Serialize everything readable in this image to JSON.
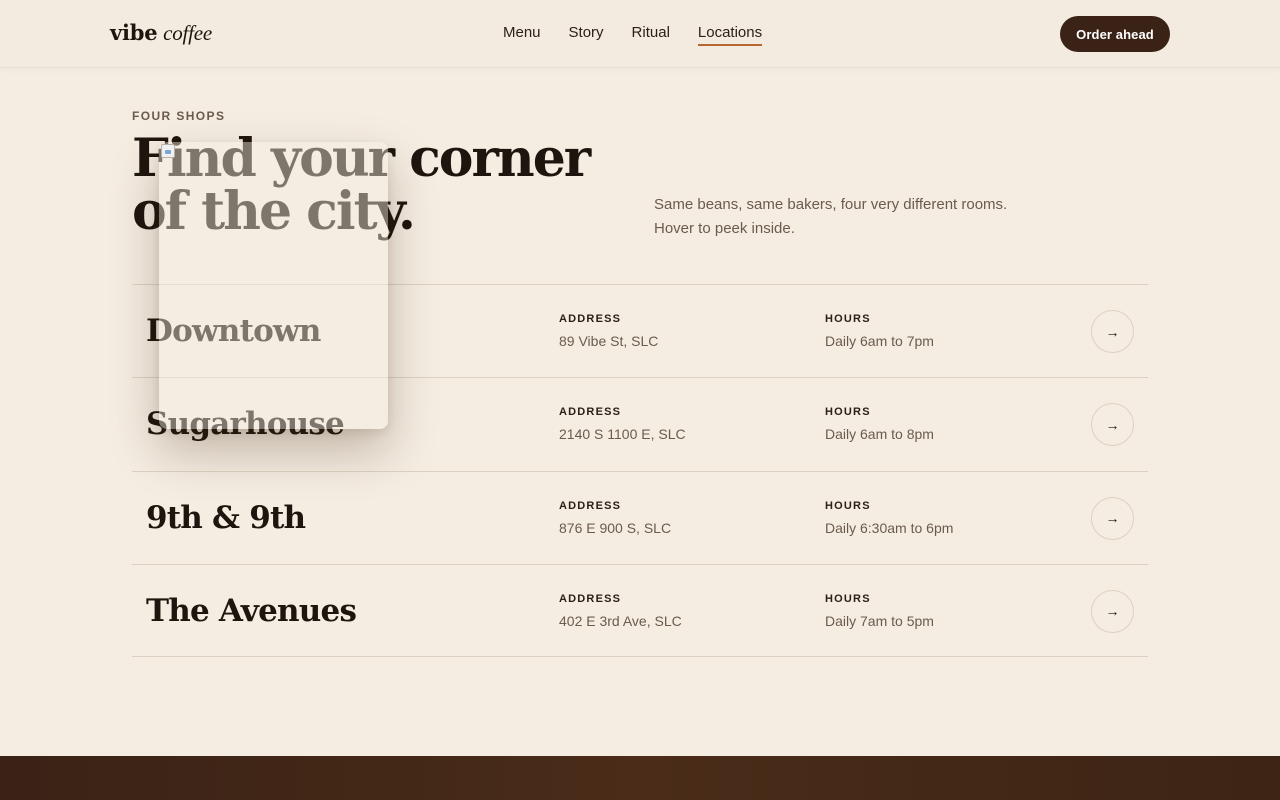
{
  "brand": {
    "logo_bold": "vibe",
    "logo_italic": "coffee"
  },
  "nav": {
    "items": [
      {
        "label": "Menu"
      },
      {
        "label": "Story"
      },
      {
        "label": "Ritual"
      },
      {
        "label": "Locations",
        "active": true
      }
    ],
    "cta_label": "Order ahead"
  },
  "hero": {
    "eyebrow": "FOUR SHOPS",
    "title": "Find your corner of the city.",
    "subtitle": "Same beans, same bakers, four very different rooms. Hover to peek inside."
  },
  "locations": {
    "address_label": "ADDRESS",
    "hours_label": "HOURS",
    "items": [
      {
        "name": "Downtown",
        "address": "89 Vibe St, SLC",
        "hours": "Daily 6am to 7pm"
      },
      {
        "name": "Sugarhouse",
        "address": "2140 S 1100 E, SLC",
        "hours": "Daily 6am to 8pm"
      },
      {
        "name": "9th & 9th",
        "address": "876 E 900 S, SLC",
        "hours": "Daily 6:30am to 6pm"
      },
      {
        "name": "The Avenues",
        "address": "402 E 3rd Ave, SLC",
        "hours": "Daily 7am to 5pm"
      }
    ]
  },
  "icons": {
    "arrow": "arrow-right-icon",
    "broken_image": "broken-image-icon"
  },
  "colors": {
    "accent": "#b8672e",
    "brand_dark": "#3a2216",
    "background": "#f5ede2"
  }
}
